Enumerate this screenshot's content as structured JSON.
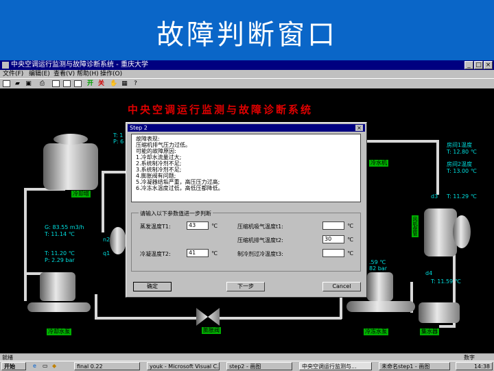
{
  "slide": {
    "title": "故障判断窗口"
  },
  "window": {
    "title": "中央空调运行监测与故障诊断系统 - 重庆大学",
    "controls": [
      "_",
      "□",
      "×"
    ]
  },
  "menu": [
    "文件(F)",
    "编辑(E)",
    "查看(V)",
    "帮助(H)",
    "操作(O)"
  ],
  "toolbar": {
    "start_label": "开",
    "stop_label": "关"
  },
  "diagram": {
    "system_title": "中央空调运行监测与故障诊断系统",
    "labels": {
      "cooling_tower": "冷却塔",
      "cooling_pump": "冷却水泵",
      "expansion_valve": "膨胀阀",
      "chilled_pump": "冷冻水泵",
      "water_divider": "集水器",
      "chiller": "冷水机",
      "fan_coil": "风机盘管"
    },
    "readouts": {
      "tower_t": "T: 1",
      "tower_p": "P: 6",
      "cond_flow": "G: 83.55 m3/h",
      "cond_t1": "T: 11.14 ℃",
      "cond_t2": "T: 11.20 ℃",
      "cond_p": "P: 2.29 bar",
      "room1": "房间1温度",
      "room1_t": "T: 12.80 ℃",
      "room2": "房间2温度",
      "room2_t": "T: 13.00 ℃",
      "d3": "d3",
      "d3_t": "T: 11.29 ℃",
      "evap_t": ".59 ℃",
      "evap_p": "82 bar",
      "d4": "d4",
      "d4_t": "T: 11.59 ℃",
      "n2": "n2",
      "q1": "q1"
    }
  },
  "dialog": {
    "title": "Step 2",
    "close": "×",
    "diagnosis_lines": [
      "故障表现:",
      "压缩机排气压力过低。",
      "",
      "可能的故障原因:",
      "1.冷却水流量过大;",
      "2.系统制冷剂不足;",
      "3.系统制冷剂不足;",
      "4.膨胀阀有问题;",
      "5.冷凝器结垢严重，高压压力过高;",
      "6.冷冻水温度过低，高低压都降低。"
    ],
    "group_label": "请输入以下参数值进一步判断",
    "fields": [
      {
        "label": "蒸发温度T1:",
        "value": "43",
        "unit": "℃"
      },
      {
        "label": "冷凝温度T2:",
        "value": "41",
        "unit": "℃"
      },
      {
        "label": "压缩机吸气温度t1:",
        "value": "",
        "unit": "℃"
      },
      {
        "label": "压缩机排气温度t2:",
        "value": "30",
        "unit": "℃"
      },
      {
        "label": "制冷剂过冷温度t3:",
        "value": "",
        "unit": "℃"
      }
    ],
    "buttons": {
      "ok": "确定",
      "next": "下一步",
      "cancel": "Cancel"
    }
  },
  "statusbar": {
    "left": "就绪",
    "right": "数字"
  },
  "taskbar": {
    "start": "开始",
    "items": [
      "final 0.22",
      "youk - Microsoft Visual C...",
      "step2 - 画图",
      "中央空调运行监测与...",
      "未命名step1 - 画图"
    ],
    "clock": "14:38"
  }
}
